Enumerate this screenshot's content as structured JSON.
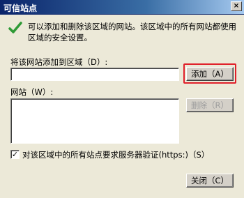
{
  "window": {
    "title": "可信站点",
    "close_label": "×"
  },
  "info": {
    "text": "可以添加和删除该区域的网站。该区域中的所有网站都使用区域的安全设置。"
  },
  "add_site": {
    "label": "将该网站添加到区域（D）:",
    "value": "",
    "button_label": "添加（A）"
  },
  "sites": {
    "label": "网站（W）:",
    "items": [],
    "remove_label": "删除（R）"
  },
  "verify": {
    "label": "对该区域中的所有站点要求服务器验证(https:)（S）",
    "checked": true,
    "check_glyph": "✓"
  },
  "footer": {
    "close_button_label": "关闭（C）"
  },
  "colors": {
    "accent_highlight": "#e0202a",
    "title_bar": "#0a246a"
  }
}
